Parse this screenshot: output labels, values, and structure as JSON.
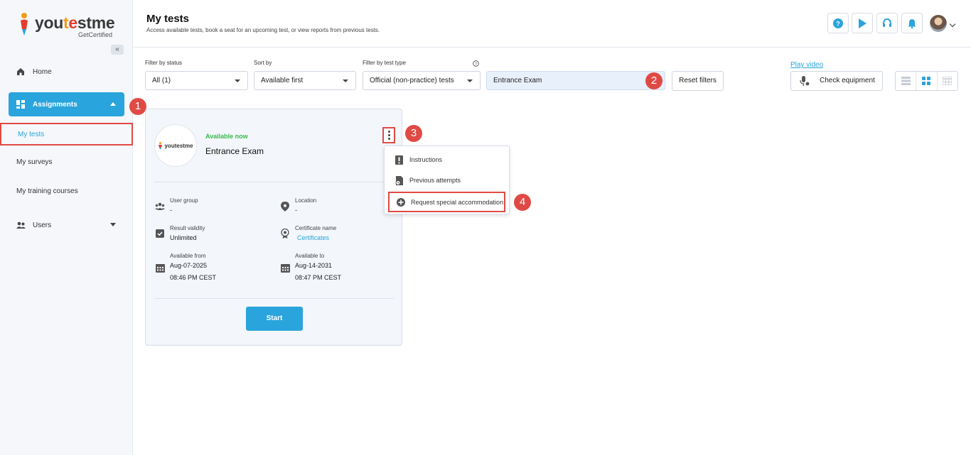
{
  "brand": {
    "name_a": "you",
    "name_b": "t",
    "name_c": "e",
    "name_d": "stme",
    "tagline": "GetCertified"
  },
  "sidebar": {
    "collapse_glyph": "«",
    "home": "Home",
    "assignments": "Assignments",
    "sub_items": [
      "My tests",
      "My surveys",
      "My training courses"
    ],
    "users": "Users"
  },
  "header": {
    "title": "My tests",
    "subtitle": "Access available tests, book a seat for an upcoming test, or view reports from previous tests."
  },
  "filters": {
    "status_label": "Filter by status",
    "status_value": "All (1)",
    "sort_label": "Sort by",
    "sort_value": "Available first",
    "type_label": "Filter by test type",
    "type_value": "Official (non-practice) tests",
    "search_value": "Entrance Exam",
    "reset_label": "Reset filters",
    "play_video": "Play video",
    "check_equipment": "Check equipment"
  },
  "card": {
    "logo_text": "youtestme",
    "status": "Available now",
    "test_name": "Entrance Exam",
    "fields": {
      "user_group_label": "User group",
      "user_group_value": "-",
      "location_label": "Location",
      "location_value": "-",
      "result_validity_label": "Result validity",
      "result_validity_value": "Unlimited",
      "certificate_label": "Certificate name",
      "certificate_value": "Certificates",
      "available_from_label": "Available from",
      "available_from_date": "Aug-07-2025",
      "available_from_time": "08:46 PM CEST",
      "available_to_label": "Available to",
      "available_to_date": "Aug-14-2031",
      "available_to_time": "08:47 PM CEST"
    },
    "start_label": "Start"
  },
  "menu": {
    "items": [
      "Instructions",
      "Previous attempts",
      "Request special accommodation"
    ]
  },
  "markers": [
    "1",
    "2",
    "3",
    "4"
  ],
  "colors": {
    "accent": "#2aa4dc",
    "marker": "#e04a45",
    "available": "#3bb94b"
  }
}
